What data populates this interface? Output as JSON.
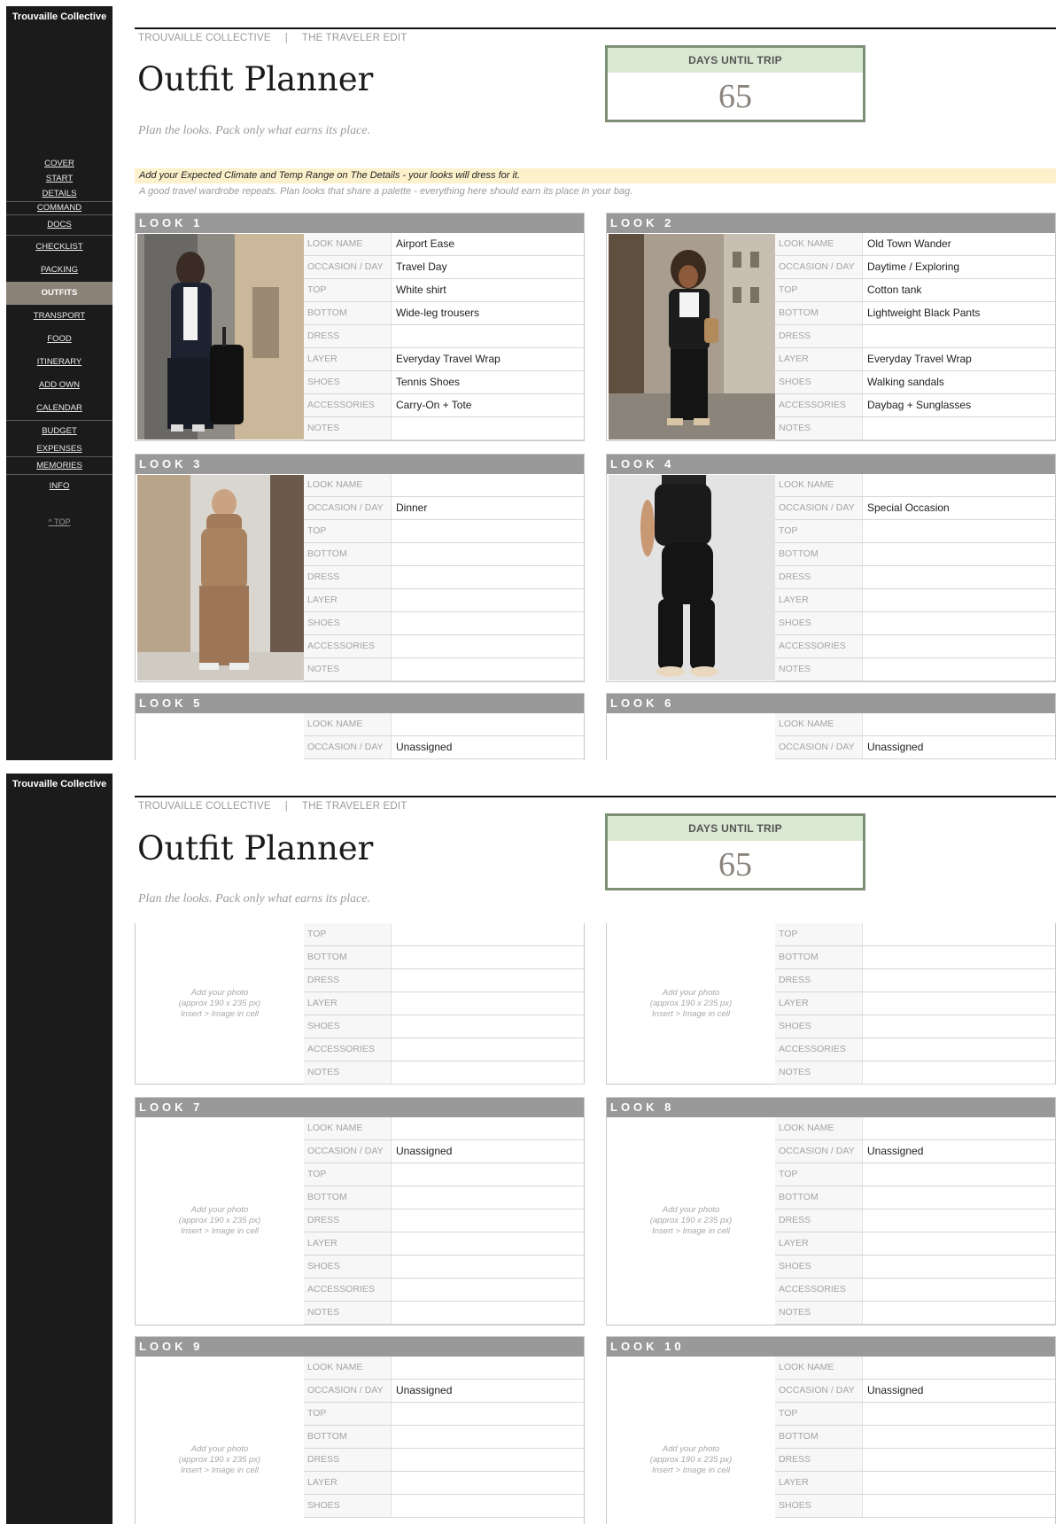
{
  "brand": "Trouvaille Collective",
  "nav": {
    "items": [
      {
        "label": "COVER"
      },
      {
        "label": "START"
      },
      {
        "label": "DETAILS"
      },
      {
        "label": "COMMAND"
      },
      {
        "label": "DOCS"
      },
      {
        "label": "CHECKLIST"
      },
      {
        "label": "PACKING"
      },
      {
        "label": "OUTFITS",
        "active": true
      },
      {
        "label": "TRANSPORT"
      },
      {
        "label": "FOOD"
      },
      {
        "label": "ITINERARY"
      },
      {
        "label": "ADD OWN"
      },
      {
        "label": "CALENDAR"
      },
      {
        "label": "BUDGET"
      },
      {
        "label": "EXPENSES"
      },
      {
        "label": "MEMORIES"
      },
      {
        "label": "INFO"
      }
    ],
    "top_link": "^ TOP"
  },
  "header": {
    "crumb1": "TROUVAILLE COLLECTIVE",
    "crumb_sep": "|",
    "crumb2": "THE TRAVELER EDIT",
    "title": "Outfit Planner",
    "tagline": "Plan the looks. Pack only what earns its place."
  },
  "days_until_trip": {
    "label": "DAYS UNTIL TRIP",
    "value": "65"
  },
  "notice": "Add your Expected Climate and Temp Range on The Details - your looks will dress for it.",
  "hint": "A good travel wardrobe repeats. Plan looks that share a palette - everything here should earn its place in your bag.",
  "photo_placeholder": {
    "line1": "Add your photo",
    "line2": "(approx 190 x 235 px)",
    "line3": "Insert > Image in cell"
  },
  "field_labels": {
    "look_name": "LOOK NAME",
    "occasion": "OCCASION / DAY",
    "top": "TOP",
    "bottom": "BOTTOM",
    "dress": "DRESS",
    "layer": "LAYER",
    "shoes": "SHOES",
    "accessories": "ACCESSORIES",
    "notes": "NOTES"
  },
  "looks": [
    {
      "title": "LOOK 1",
      "look_name": "Airport Ease",
      "occasion": "Travel Day",
      "top": "White shirt",
      "bottom": "Wide-leg trousers",
      "dress": "",
      "layer": "Everyday Travel Wrap",
      "shoes": "Tennis Shoes",
      "accessories": "Carry-On + Tote",
      "notes": ""
    },
    {
      "title": "LOOK 2",
      "look_name": "Old Town Wander",
      "occasion": "Daytime / Exploring",
      "top": "Cotton tank",
      "bottom": "Lightweight Black Pants",
      "dress": "",
      "layer": "Everyday Travel Wrap",
      "shoes": "Walking sandals",
      "accessories": "Daybag + Sunglasses",
      "notes": ""
    },
    {
      "title": "LOOK 3",
      "look_name": "",
      "occasion": "Dinner",
      "top": "",
      "bottom": "",
      "dress": "",
      "layer": "",
      "shoes": "",
      "accessories": "",
      "notes": ""
    },
    {
      "title": "LOOK 4",
      "look_name": "",
      "occasion": "Special Occasion",
      "top": "",
      "bottom": "",
      "dress": "",
      "layer": "",
      "shoes": "",
      "accessories": "",
      "notes": ""
    },
    {
      "title": "LOOK 5",
      "look_name": "",
      "occasion": "Unassigned"
    },
    {
      "title": "LOOK 6",
      "look_name": "",
      "occasion": "Unassigned"
    },
    {
      "title": "LOOK 7",
      "look_name": "",
      "occasion": "Unassigned"
    },
    {
      "title": "LOOK 8",
      "look_name": "",
      "occasion": "Unassigned"
    },
    {
      "title": "LOOK 9",
      "look_name": "",
      "occasion": "Unassigned"
    },
    {
      "title": "LOOK 10",
      "look_name": "",
      "occasion": "Unassigned"
    }
  ]
}
